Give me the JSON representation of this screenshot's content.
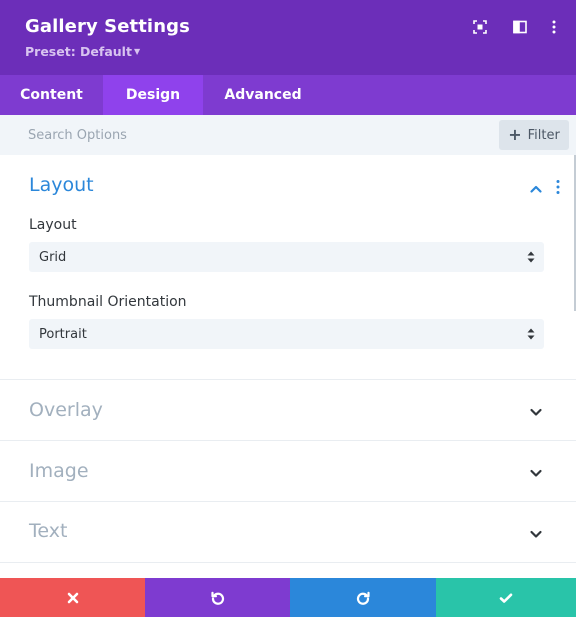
{
  "header": {
    "title": "Gallery Settings",
    "preset_label": "Preset: Default",
    "icons": [
      "fullscreen-icon",
      "split-view-icon",
      "more-options-icon"
    ]
  },
  "tabs": [
    {
      "label": "Content",
      "active": false
    },
    {
      "label": "Design",
      "active": true
    },
    {
      "label": "Advanced",
      "active": false
    }
  ],
  "search": {
    "placeholder": "Search Options",
    "value": "",
    "filter_label": "Filter"
  },
  "sections": {
    "layout": {
      "title": "Layout",
      "expanded": true,
      "fields": [
        {
          "label": "Layout",
          "value": "Grid"
        },
        {
          "label": "Thumbnail Orientation",
          "value": "Portrait"
        }
      ]
    },
    "collapsed": [
      {
        "title": "Overlay"
      },
      {
        "title": "Image"
      },
      {
        "title": "Text"
      }
    ]
  },
  "bottom_bar": {
    "actions": [
      "cancel",
      "undo",
      "redo",
      "save"
    ]
  },
  "colors": {
    "header_bg": "#6c2eb9",
    "tabs_bg": "#7e3bd0",
    "active_tab_bg": "#8f42ec",
    "accent_blue": "#2b87da",
    "cancel": "#ef5555",
    "undo": "#7e3bd0",
    "redo": "#2b87da",
    "save": "#29c4a9"
  }
}
